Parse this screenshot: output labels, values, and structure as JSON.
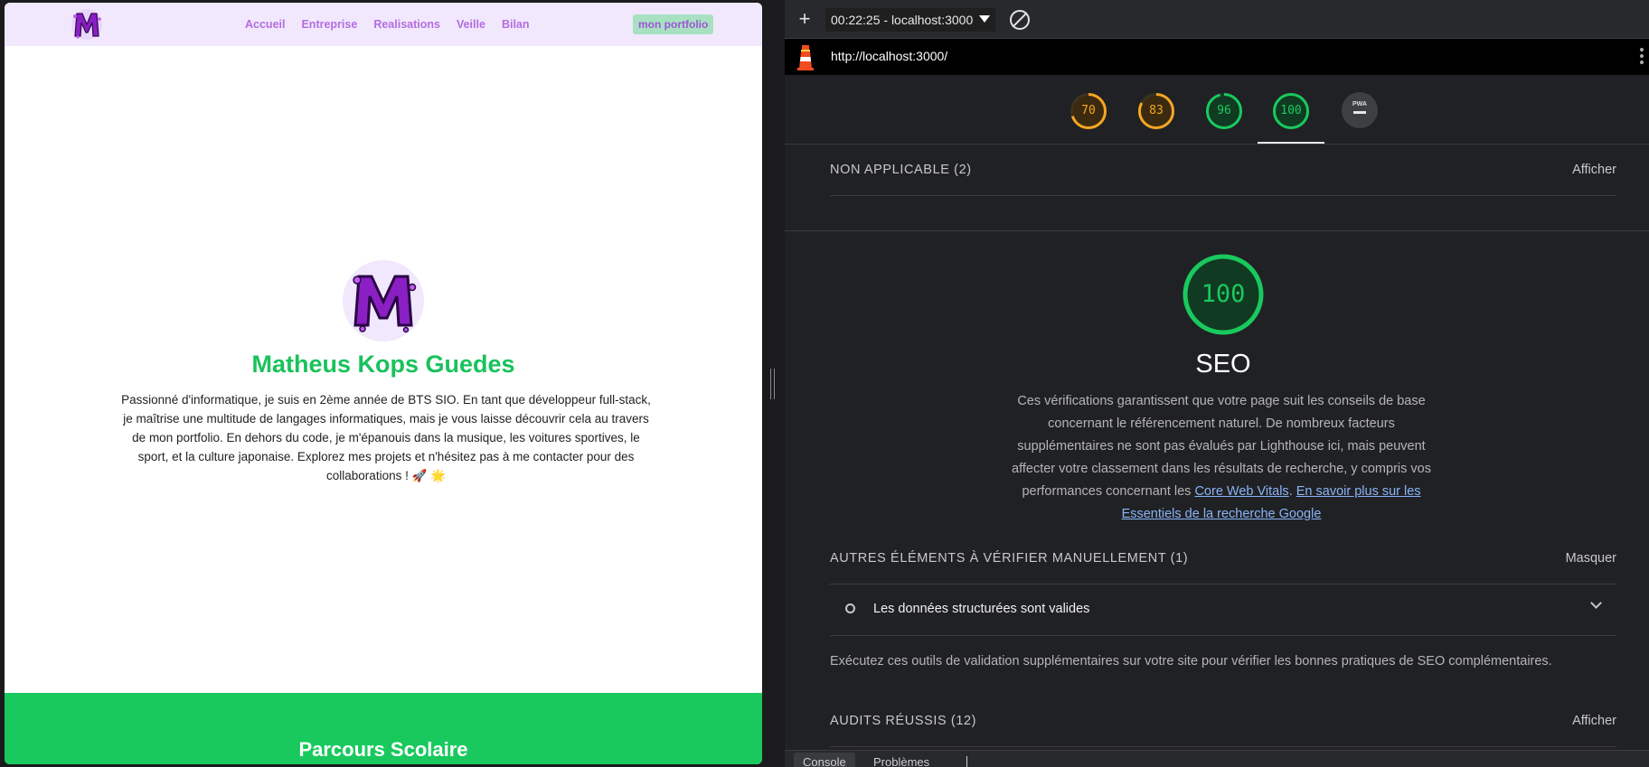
{
  "site": {
    "nav": {
      "links": [
        "Accueil",
        "Entreprise",
        "Realisations",
        "Veille",
        "Bilan"
      ],
      "cta": "mon portfolio"
    },
    "hero": {
      "name": "Matheus Kops Guedes",
      "bio": "Passionné d'informatique, je suis en 2ème année de BTS SIO. En tant que développeur full-stack, je maîtrise une multitude de langages informatiques, mais je vous laisse découvrir cela au travers de mon portfolio. En dehors du code, je m'épanouis dans la musique, les voitures sportives, le sport, et la culture japonaise. Explorez mes projets et n'hésitez pas à me contacter pour des collaborations ! 🚀 🌟"
    },
    "section_title": "Parcours Scolaire",
    "colors": {
      "accent_green": "#19c95e",
      "accent_purple": "#b46de0",
      "nav_bg": "#f1e8fd"
    }
  },
  "devtools": {
    "toolbar": {
      "report": "00:22:25 - localhost:3000"
    },
    "url": "http://localhost:3000/",
    "scores": [
      {
        "key": "performance",
        "value": 70,
        "color": "#f4a622"
      },
      {
        "key": "accessibility",
        "value": 83,
        "color": "#f4a622"
      },
      {
        "key": "best-practices",
        "value": 96,
        "color": "#19c95e"
      },
      {
        "key": "seo",
        "value": 100,
        "color": "#19c95e"
      }
    ],
    "pwa_label": "PWA",
    "not_applicable": {
      "title": "NON APPLICABLE (2)",
      "action": "Afficher"
    },
    "seo": {
      "score": 100,
      "title": "SEO",
      "desc_before": "Ces vérifications garantissent que votre page suit les conseils de base concernant le référencement naturel. De nombreux facteurs supplémentaires ne sont pas évalués par Lighthouse ici, mais peuvent affecter votre classement dans les résultats de recherche, y compris vos performances concernant les ",
      "link_cwv": "Core Web Vitals",
      "desc_mid": ". ",
      "link_more": "En savoir plus sur les Essentiels de la recherche Google"
    },
    "manual": {
      "title": "AUTRES ÉLÉMENTS À VÉRIFIER MANUELLEMENT (1)",
      "action": "Masquer",
      "item": "Les données structurées sont valides",
      "note": "Exécutez ces outils de validation supplémentaires sur votre site pour vérifier les bonnes pratiques de SEO complémentaires."
    },
    "passed": {
      "title": "AUDITS RÉUSSIS (12)",
      "action": "Afficher"
    },
    "drawer": {
      "tabs": [
        "Console",
        "Problèmes"
      ]
    }
  }
}
